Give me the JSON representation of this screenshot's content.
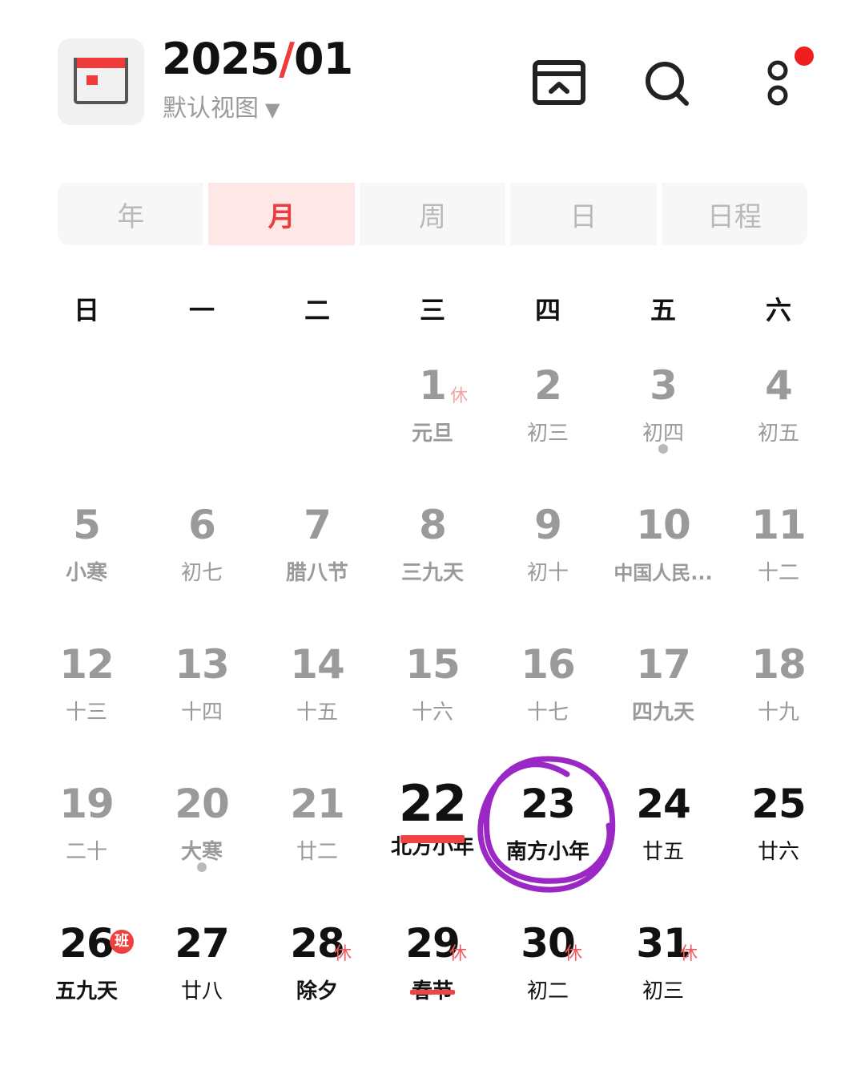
{
  "header": {
    "year": "2025",
    "sep": "/",
    "month": "01",
    "view_label": "默认视图",
    "view_caret": "▼"
  },
  "tabs": [
    {
      "label": "年",
      "active": false
    },
    {
      "label": "月",
      "active": true
    },
    {
      "label": "周",
      "active": false
    },
    {
      "label": "日",
      "active": false
    },
    {
      "label": "日程",
      "active": false
    }
  ],
  "weekdays": [
    "日",
    "一",
    "二",
    "三",
    "四",
    "五",
    "六"
  ],
  "weeks": [
    [
      {
        "day": "",
        "lunar": ""
      },
      {
        "day": "",
        "lunar": ""
      },
      {
        "day": "",
        "lunar": ""
      },
      {
        "day": "1",
        "lunar": "元旦",
        "tag": "休"
      },
      {
        "day": "2",
        "lunar": "初三"
      },
      {
        "day": "3",
        "lunar": "初四"
      },
      {
        "day": "4",
        "lunar": "初五"
      }
    ],
    [
      {
        "day": "5",
        "lunar": "小寒"
      },
      {
        "day": "6",
        "lunar": "初七"
      },
      {
        "day": "7",
        "lunar": "腊八节"
      },
      {
        "day": "8",
        "lunar": "三九天"
      },
      {
        "day": "9",
        "lunar": "初十"
      },
      {
        "day": "10",
        "lunar": "中国人民..."
      },
      {
        "day": "11",
        "lunar": "十二"
      }
    ],
    [
      {
        "day": "12",
        "lunar": "十三"
      },
      {
        "day": "13",
        "lunar": "十四"
      },
      {
        "day": "14",
        "lunar": "十五"
      },
      {
        "day": "15",
        "lunar": "十六"
      },
      {
        "day": "16",
        "lunar": "十七"
      },
      {
        "day": "17",
        "lunar": "四九天"
      },
      {
        "day": "18",
        "lunar": "十九"
      }
    ],
    [
      {
        "day": "19",
        "lunar": "二十"
      },
      {
        "day": "20",
        "lunar": "大寒"
      },
      {
        "day": "21",
        "lunar": "廿二"
      },
      {
        "day": "22",
        "lunar": "北方小年"
      },
      {
        "day": "23",
        "lunar": "南方小年"
      },
      {
        "day": "24",
        "lunar": "廿五"
      },
      {
        "day": "25",
        "lunar": "廿六"
      }
    ],
    [
      {
        "day": "26",
        "lunar": "五九天",
        "badge": "班"
      },
      {
        "day": "27",
        "lunar": "廿八"
      },
      {
        "day": "28",
        "lunar": "除夕",
        "tag": "休"
      },
      {
        "day": "29",
        "lunar": "春节",
        "tag": "休"
      },
      {
        "day": "30",
        "lunar": "初二",
        "tag": "休"
      },
      {
        "day": "31",
        "lunar": "初三",
        "tag": "休"
      },
      {
        "day": "",
        "lunar": ""
      }
    ]
  ],
  "colors": {
    "accent": "#ef3b3b",
    "annotation": "#9b27c4",
    "muted": "#9a9a9a"
  },
  "icons": [
    "calendar-app-icon",
    "calendar-collapse-icon",
    "search-icon",
    "more-icon",
    "notification-dot"
  ]
}
